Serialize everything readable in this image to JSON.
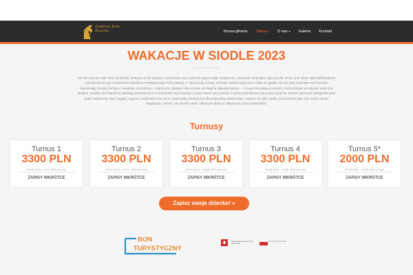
{
  "brand": {
    "logo_text": "Stadnina Koni Runowo"
  },
  "nav": {
    "items": [
      {
        "label": "Strona główna",
        "active": false,
        "has_caret": false
      },
      {
        "label": "Oferta",
        "active": true,
        "has_caret": true
      },
      {
        "label": "O nas",
        "active": false,
        "has_caret": true
      },
      {
        "label": "Galeria",
        "active": false,
        "has_caret": false
      },
      {
        "label": "Kontakt",
        "active": false,
        "has_caret": false
      }
    ]
  },
  "hero": {
    "title": "WAKACJE W SIODLE 2023",
    "intro": "Nie bez powodu nasz obóz jeździecki zdobywa od lat zaufanie uczestników oraz rodziców zapewniając bezpieczny i niezwykle atrakcyjny wypoczynek. Dzieci pod okiem wykwalifikowanych instruktorów (w tym Instruktorów Szkolenia Podstawowego PZJ) odbędą 17 lekcji jazdy konnej. Ośrodek zlokalizowany jest z dala od zgiełku, na wsi; przy Stadninie Koni Runowo zapewniając bezpieczeństwo i swobodę uczestnikom. Stajnia jest zaledwie kilka metrów od miejsca zakwaterowania – z czego korzystają uczestnicy osoby lubiące przebywać stale przy koniach. Opiekę nad młodzieżą sprawują doświadczeni i kompetentni wychowawcy (często dawni obozowicze). Kolonie jeździeckie w Runowie wyróżnia również obecność pielęgniarki jako opieki medycznej. Nasz bogaty program został stworzony przez pasjonatów jeździectwa dla pasjonatów jeździectwa i zawiera nie tylko tajniki sztuki jeździeckiej oraz naukę opieki i współżycia z końmi, ale również wiele ciekawych atrakcji i aktywności poza jeździeckich."
  },
  "turnusy": {
    "title": "Turnusy",
    "cards": [
      {
        "name": "Turnus 1",
        "price": "3300 PLN",
        "dates": "25.06.2023 – 8.07.2023 (14 dni)",
        "cta": "ZAPISY WKRÓTCE"
      },
      {
        "name": "Turnus 2",
        "price": "3300 PLN",
        "dates": "09.07.2023 – 22.07.2023 (14 dni)",
        "cta": "ZAPISY WKRÓTCE"
      },
      {
        "name": "Turnus 3",
        "price": "3300 PLN",
        "dates": "23.07.2023 – 05.08.2023 (14 dni)",
        "cta": "ZAPISY WKRÓTCE"
      },
      {
        "name": "Turnus 4",
        "price": "3300 PLN",
        "dates": "06.08.2023 – 19.08.2023 (14 dni)",
        "cta": "ZAPISY WKRÓTCE"
      },
      {
        "name": "Turnus 5*",
        "price": "2000 PLN",
        "dates": "20.08.2023 – 26.08.2023 (7 dni)",
        "cta": "ZAPISY WKRÓTCE"
      }
    ]
  },
  "signup_button": "Zapisz swoje dziecko! »",
  "partners": {
    "bon_line1": "BON",
    "bon_line2": "TURYSTYCZNY",
    "ministry": "Ministerstwo Rozwoju Pracy i Technologii",
    "rp_text": "Rzeczpospolita Polska"
  },
  "colors": {
    "accent": "#ef6c2a",
    "header_bg": "#2b2b2b"
  }
}
